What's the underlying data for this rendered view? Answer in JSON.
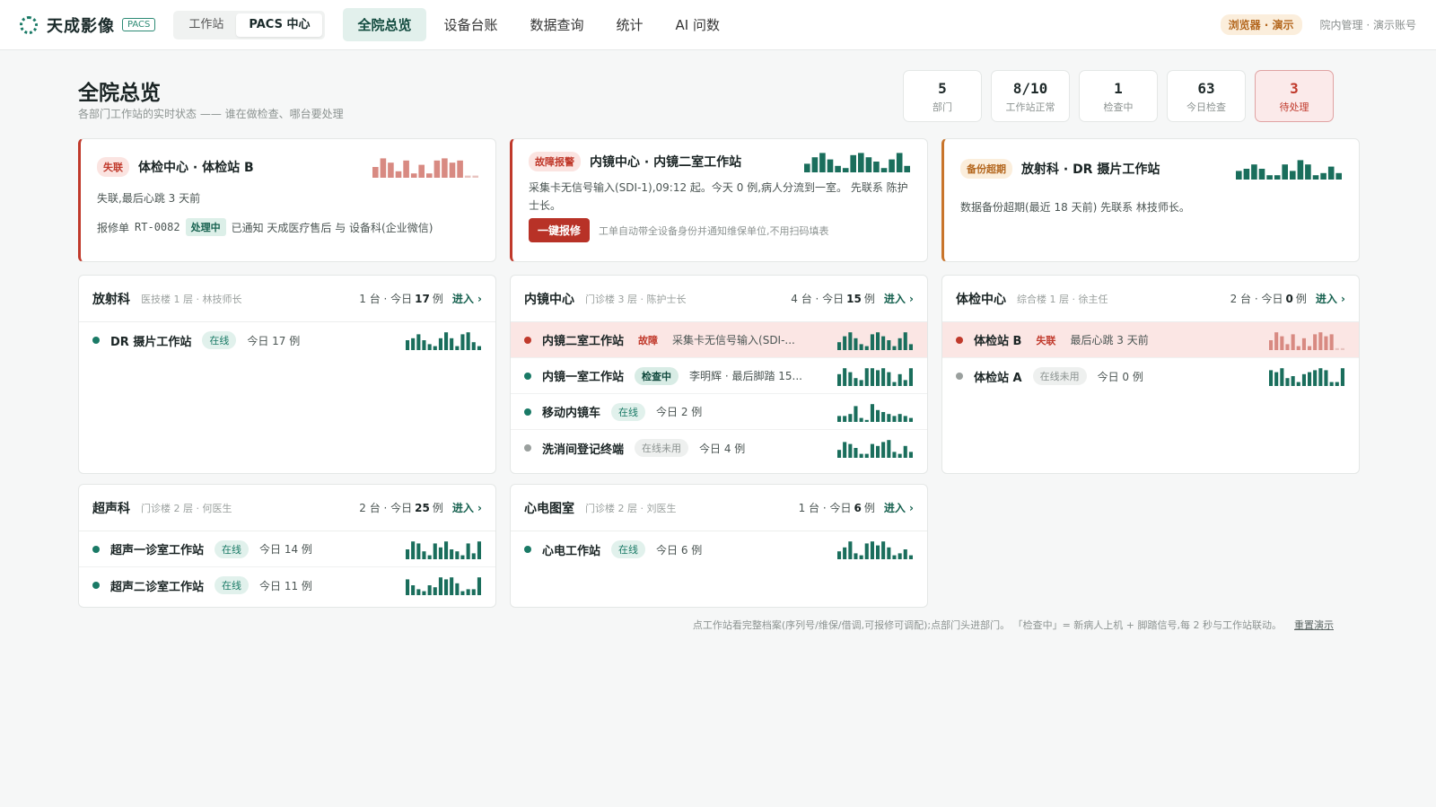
{
  "app": {
    "title": "天成影像",
    "tag": "PACS"
  },
  "modes": [
    "工作站",
    "PACS 中心"
  ],
  "nav": [
    "全院总览",
    "设备台账",
    "数据查询",
    "统计",
    "AI 问数"
  ],
  "demo_badge": "浏览器 · 演示",
  "account": "院内管理 · 演示账号",
  "page": {
    "title": "全院总览",
    "subtitle": "各部门工作站的实时状态 —— 谁在做检查、哪台要处理"
  },
  "stats": [
    {
      "value": "5",
      "label": "部门"
    },
    {
      "value": "8/10",
      "label": "工作站正常"
    },
    {
      "value": "1",
      "label": "检查中"
    },
    {
      "value": "63",
      "label": "今日检查"
    },
    {
      "value": "3",
      "label": "待处理"
    }
  ],
  "alerts": [
    {
      "tag": "失联",
      "title": "体检中心 · 体检站 B",
      "text": "失联,最后心跳 3 天前",
      "ticket_prefix": "报修单",
      "ticket": "RT-0082",
      "status": "处理中",
      "note": "已通知 天成医疗售后 与 设备科(企业微信)"
    },
    {
      "tag": "故障报警",
      "title": "内镜中心 · 内镜二室工作站",
      "text": "采集卡无信号输入(SDI-1),09:12 起。今天 0 例,病人分流到一室。 先联系 陈护士长。",
      "button": "一键报修",
      "hint": "工单自动带全设备身份并通知维保单位,不用扫码填表"
    },
    {
      "tag": "备份超期",
      "title": "放射科 · DR 摄片工作站",
      "text": "数据备份超期(最近 18 天前) 先联系 林技师长。"
    }
  ],
  "departments": [
    {
      "name": "放射科",
      "meta": "医技楼 1 层 · 林技师长",
      "count_text": "1 台 · 今日",
      "today": "17",
      "unit": "例",
      "enter": "进入 ›",
      "rows": [
        {
          "name": "DR 摄片工作站",
          "status": "在线",
          "info": "今日 17 例"
        }
      ]
    },
    {
      "name": "内镜中心",
      "meta": "门诊楼 3 层 · 陈护士长",
      "count_text": "4 台 · 今日",
      "today": "15",
      "unit": "例",
      "enter": "进入 ›",
      "rows": [
        {
          "name": "内镜二室工作站",
          "status": "故障",
          "info": "采集卡无信号输入(SDI-..."
        },
        {
          "name": "内镜一室工作站",
          "status": "检查中",
          "info": "李明辉 · 最后脚踏 15..."
        },
        {
          "name": "移动内镜车",
          "status": "在线",
          "info": "今日 2 例"
        },
        {
          "name": "洗消间登记终端",
          "status": "在线未用",
          "info": "今日 4 例"
        }
      ]
    },
    {
      "name": "体检中心",
      "meta": "综合楼 1 层 · 徐主任",
      "count_text": "2 台 · 今日",
      "today": "0",
      "unit": "例",
      "enter": "进入 ›",
      "rows": [
        {
          "name": "体检站 B",
          "status": "失联",
          "info": "最后心跳 3 天前"
        },
        {
          "name": "体检站 A",
          "status": "在线未用",
          "info": "今日 0 例"
        }
      ]
    },
    {
      "name": "超声科",
      "meta": "门诊楼 2 层 · 何医生",
      "count_text": "2 台 · 今日",
      "today": "25",
      "unit": "例",
      "enter": "进入 ›",
      "rows": [
        {
          "name": "超声一诊室工作站",
          "status": "在线",
          "info": "今日 14 例"
        },
        {
          "name": "超声二诊室工作站",
          "status": "在线",
          "info": "今日 11 例"
        }
      ]
    },
    {
      "name": "心电图室",
      "meta": "门诊楼 2 层 · 刘医生",
      "count_text": "1 台 · 今日",
      "today": "6",
      "unit": "例",
      "enter": "进入 ›",
      "rows": [
        {
          "name": "心电工作站",
          "status": "在线",
          "info": "今日 6 例"
        }
      ]
    }
  ],
  "footer": {
    "text": "点工作站看完整档案(序列号/维保/借调,可报修可调配);点部门头进部门。 「检查中」= 新病人上机 + 脚踏信号,每 2 秒与工作站联动。",
    "link": "重置演示"
  },
  "colors": {
    "accent": "#1a7a66",
    "danger": "#c0392b",
    "warning": "#b3661d"
  }
}
